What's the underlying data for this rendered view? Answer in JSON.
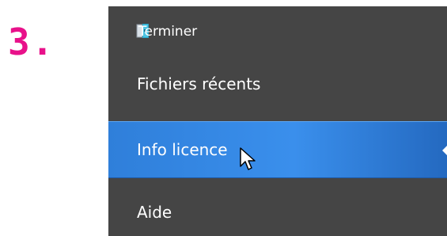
{
  "step": {
    "number": "3."
  },
  "menu": {
    "items": [
      {
        "label": "Terminer",
        "icon": "close-door-icon"
      },
      {
        "label": "Fichiers récents"
      },
      {
        "label": "Info licence",
        "highlighted": true
      },
      {
        "label": "Aide"
      }
    ]
  },
  "colors": {
    "step_number": "#e8118a",
    "menu_background": "#454545",
    "highlight": "#3a8fec",
    "text": "#ffffff"
  }
}
